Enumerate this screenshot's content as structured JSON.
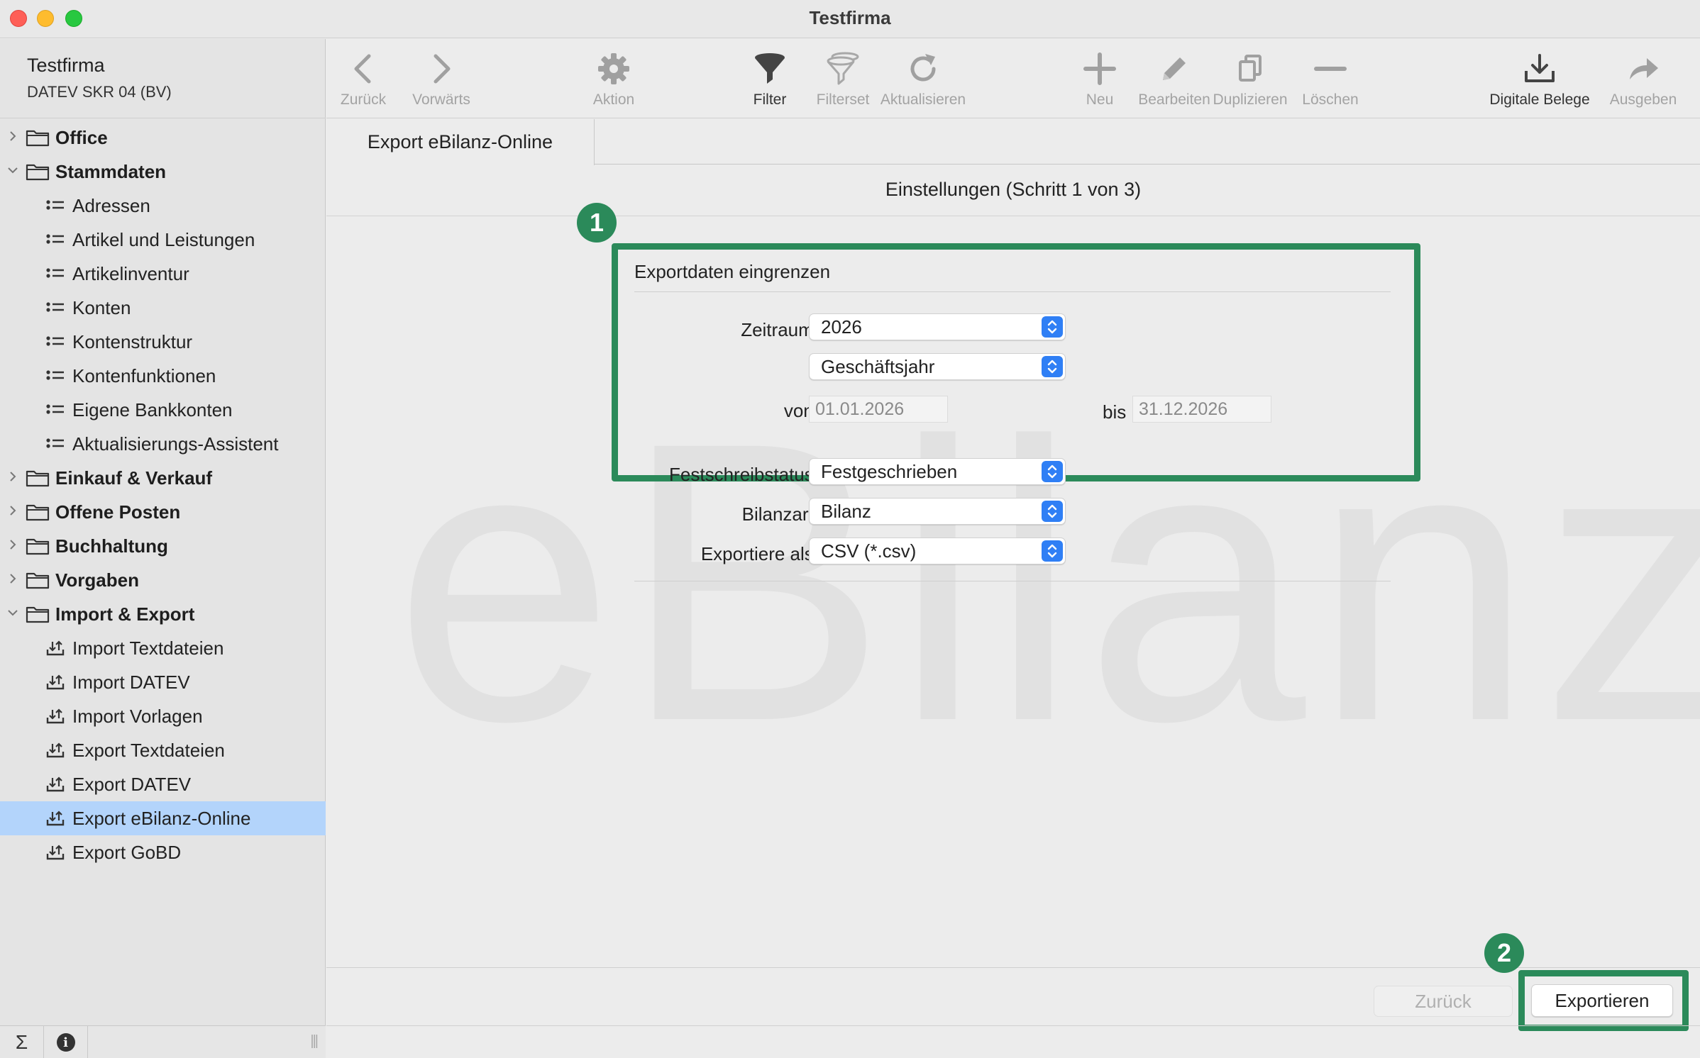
{
  "window": {
    "title": "Testfirma"
  },
  "sidebar": {
    "company_name": "Testfirma",
    "company_sub": "DATEV SKR 04 (BV)",
    "tree": [
      {
        "kind": "folder",
        "label": "Office",
        "expanded": false
      },
      {
        "kind": "folder",
        "label": "Stammdaten",
        "expanded": true
      },
      {
        "kind": "list",
        "label": "Adressen"
      },
      {
        "kind": "list",
        "label": "Artikel und Leistungen"
      },
      {
        "kind": "list",
        "label": "Artikelinventur"
      },
      {
        "kind": "list",
        "label": "Konten"
      },
      {
        "kind": "list",
        "label": "Kontenstruktur"
      },
      {
        "kind": "list",
        "label": "Kontenfunktionen"
      },
      {
        "kind": "list",
        "label": "Eigene Bankkonten"
      },
      {
        "kind": "list",
        "label": "Aktualisierungs-Assistent"
      },
      {
        "kind": "folder",
        "label": "Einkauf & Verkauf",
        "expanded": false
      },
      {
        "kind": "folder",
        "label": "Offene Posten",
        "expanded": false
      },
      {
        "kind": "folder",
        "label": "Buchhaltung",
        "expanded": false
      },
      {
        "kind": "folder",
        "label": "Vorgaben",
        "expanded": false
      },
      {
        "kind": "folder",
        "label": "Import & Export",
        "expanded": true
      },
      {
        "kind": "import",
        "label": "Import Textdateien"
      },
      {
        "kind": "import",
        "label": "Import DATEV"
      },
      {
        "kind": "import",
        "label": "Import Vorlagen"
      },
      {
        "kind": "import",
        "label": "Export Textdateien"
      },
      {
        "kind": "import",
        "label": "Export DATEV"
      },
      {
        "kind": "import",
        "label": "Export eBilanz-Online",
        "selected": true
      },
      {
        "kind": "import",
        "label": "Export GoBD"
      }
    ],
    "bottom": {
      "sum_symbol": "Σ",
      "info_symbol": "i"
    }
  },
  "toolbar": {
    "back": "Zurück",
    "forward": "Vorwärts",
    "action": "Aktion",
    "filter": "Filter",
    "filterset": "Filterset",
    "refresh": "Aktualisieren",
    "new": "Neu",
    "edit": "Bearbeiten",
    "duplicate": "Duplizieren",
    "delete": "Löschen",
    "digital_docs": "Digitale Belege",
    "output": "Ausgeben"
  },
  "tab": {
    "label": "Export eBilanz-Online"
  },
  "wizard": {
    "step_title": "Einstellungen (Schritt 1 von 3)",
    "watermark": "eBilanz+",
    "badge1": "1",
    "badge2": "2",
    "group_title": "Exportdaten eingrenzen",
    "period_label": "Zeitraum:",
    "period_year": "2026",
    "period_type": "Geschäftsjahr",
    "from_label": "von:",
    "from_value": "01.01.2026",
    "to_label": "bis",
    "to_value": "31.12.2026",
    "lock_label": "Festschreibstatus:",
    "lock_value": "Festgeschrieben",
    "balance_label": "Bilanzart:",
    "balance_value": "Bilanz",
    "export_as_label": "Exportiere als:",
    "export_as_value": "CSV (*.csv)"
  },
  "footer": {
    "back_button": "Zurück",
    "export_button": "Exportieren"
  },
  "colors": {
    "highlight": "#2b8a5a",
    "selection": "#b3d4fb",
    "select_button": "#2f7ff5"
  }
}
